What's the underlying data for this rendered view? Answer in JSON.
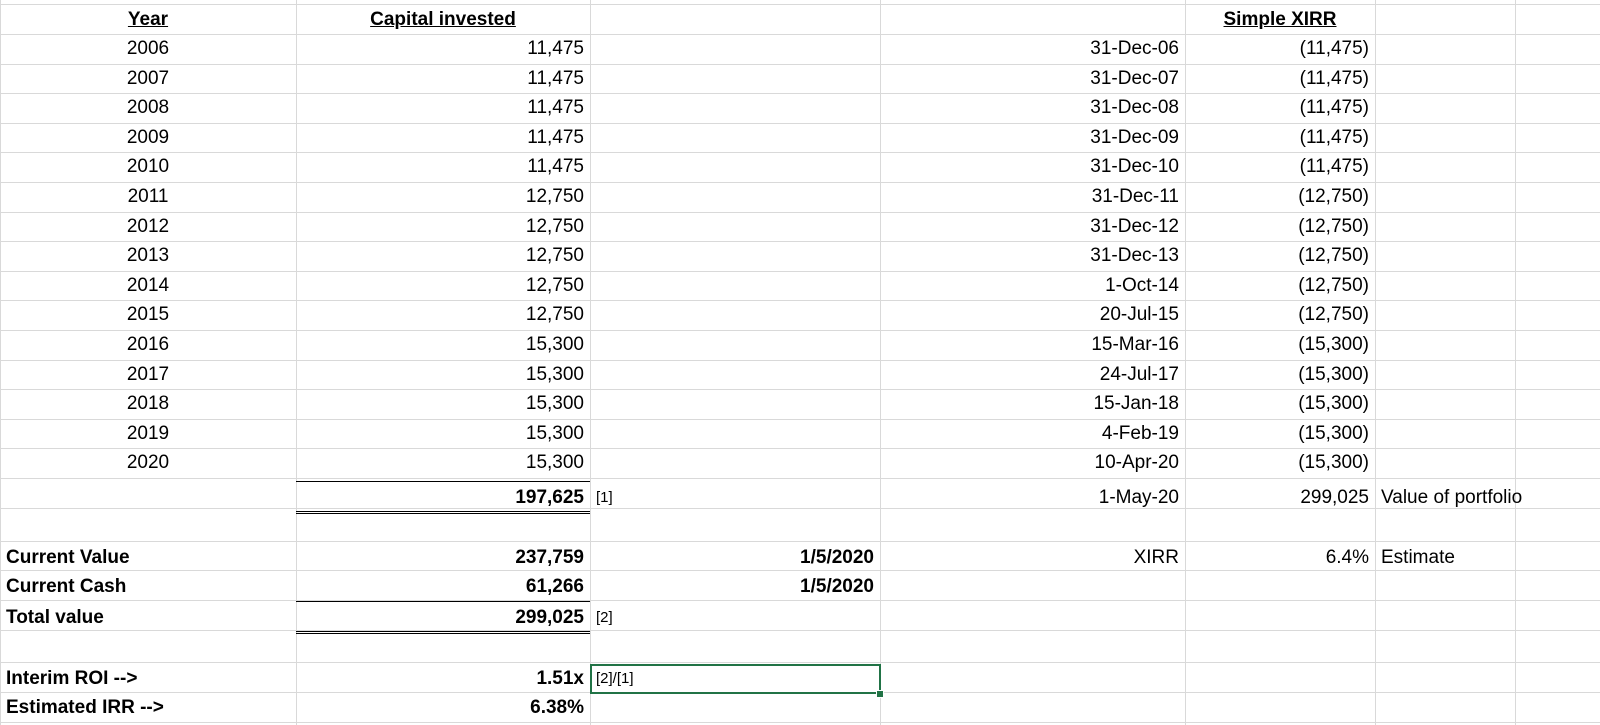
{
  "headers": {
    "year": "Year",
    "capital_invested": "Capital invested",
    "simple_xirr": "Simple XIRR"
  },
  "rows": [
    {
      "year": "2006",
      "capital": "11,475",
      "date": "31-Dec-06",
      "xirr": "(11,475)"
    },
    {
      "year": "2007",
      "capital": "11,475",
      "date": "31-Dec-07",
      "xirr": "(11,475)"
    },
    {
      "year": "2008",
      "capital": "11,475",
      "date": "31-Dec-08",
      "xirr": "(11,475)"
    },
    {
      "year": "2009",
      "capital": "11,475",
      "date": "31-Dec-09",
      "xirr": "(11,475)"
    },
    {
      "year": "2010",
      "capital": "11,475",
      "date": "31-Dec-10",
      "xirr": "(11,475)"
    },
    {
      "year": "2011",
      "capital": "12,750",
      "date": "31-Dec-11",
      "xirr": "(12,750)"
    },
    {
      "year": "2012",
      "capital": "12,750",
      "date": "31-Dec-12",
      "xirr": "(12,750)"
    },
    {
      "year": "2013",
      "capital": "12,750",
      "date": "31-Dec-13",
      "xirr": "(12,750)"
    },
    {
      "year": "2014",
      "capital": "12,750",
      "date": "1-Oct-14",
      "xirr": "(12,750)"
    },
    {
      "year": "2015",
      "capital": "12,750",
      "date": "20-Jul-15",
      "xirr": "(12,750)"
    },
    {
      "year": "2016",
      "capital": "15,300",
      "date": "15-Mar-16",
      "xirr": "(15,300)"
    },
    {
      "year": "2017",
      "capital": "15,300",
      "date": "24-Jul-17",
      "xirr": "(15,300)"
    },
    {
      "year": "2018",
      "capital": "15,300",
      "date": "15-Jan-18",
      "xirr": "(15,300)"
    },
    {
      "year": "2019",
      "capital": "15,300",
      "date": "4-Feb-19",
      "xirr": "(15,300)"
    },
    {
      "year": "2020",
      "capital": "15,300",
      "date": "10-Apr-20",
      "xirr": "(15,300)"
    }
  ],
  "total_row": {
    "capital_total": "197,625",
    "note_1": "[1]",
    "date": "1-May-20",
    "portfolio_value": "299,025",
    "portfolio_label": "Value of portfolio"
  },
  "summary": {
    "current_value_label": "Current Value",
    "current_value": "237,759",
    "current_value_date": "1/5/2020",
    "xirr_label": "XIRR",
    "xirr_value": "6.4%",
    "xirr_note": "Estimate",
    "current_cash_label": "Current Cash",
    "current_cash": "61,266",
    "current_cash_date": "1/5/2020",
    "total_value_label": "Total value",
    "total_value": "299,025",
    "note_2": "[2]",
    "interim_roi_label": "Interim ROI  -->",
    "interim_roi": "1.51x",
    "interim_roi_formula": "[2]/[1]",
    "estimated_irr_label": "Estimated IRR -->",
    "estimated_irr": "6.38%"
  },
  "colors": {
    "gridline": "#d9d9d9",
    "selection": "#217346"
  }
}
